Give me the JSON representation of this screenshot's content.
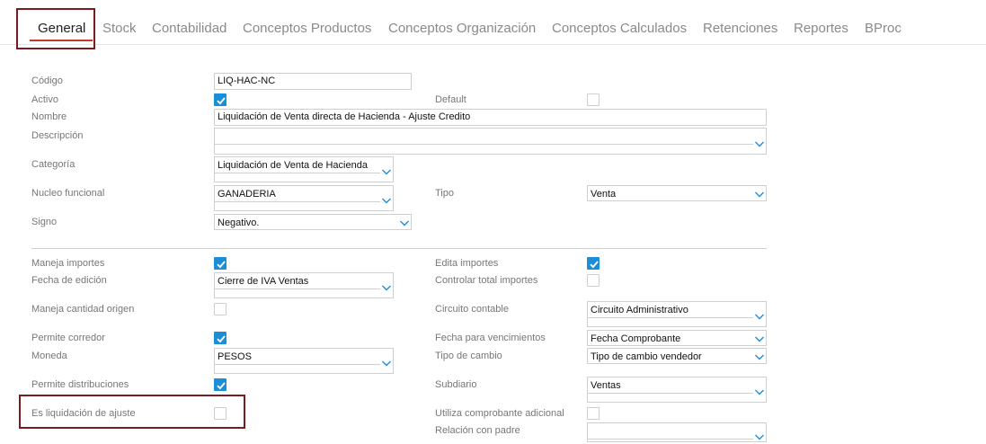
{
  "tabs": [
    {
      "label": "General",
      "active": true
    },
    {
      "label": "Stock"
    },
    {
      "label": "Contabilidad"
    },
    {
      "label": "Conceptos Productos"
    },
    {
      "label": "Conceptos Organización"
    },
    {
      "label": "Conceptos Calculados"
    },
    {
      "label": "Retenciones"
    },
    {
      "label": "Reportes"
    },
    {
      "label": "BProc"
    }
  ],
  "form": {
    "codigo": {
      "label": "Código",
      "value": "LIQ-HAC-NC"
    },
    "activo": {
      "label": "Activo",
      "checked": true
    },
    "default": {
      "label": "Default",
      "checked": false
    },
    "nombre": {
      "label": "Nombre",
      "value": "Liquidación de Venta directa de Hacienda - Ajuste Credito"
    },
    "descripcion": {
      "label": "Descripción",
      "value": ""
    },
    "categoria": {
      "label": "Categoría",
      "value": "Liquidación de Venta de Hacienda"
    },
    "nucleo": {
      "label": "Nucleo funcional",
      "value": "GANADERIA"
    },
    "tipo": {
      "label": "Tipo",
      "value": "Venta"
    },
    "signo": {
      "label": "Signo",
      "value": "Negativo."
    },
    "maneja_importes": {
      "label": "Maneja importes",
      "checked": true
    },
    "edita_importes": {
      "label": "Edita importes",
      "checked": true
    },
    "fecha_edicion": {
      "label": "Fecha de edición",
      "value": "Cierre de IVA Ventas"
    },
    "controlar_total": {
      "label": "Controlar total importes",
      "checked": false
    },
    "maneja_cantidad": {
      "label": "Maneja cantidad origen",
      "checked": false
    },
    "circuito": {
      "label": "Circuito contable",
      "value": "Circuito Administrativo"
    },
    "permite_corredor": {
      "label": "Permite corredor",
      "checked": true
    },
    "fecha_vencimientos": {
      "label": "Fecha para vencimientos",
      "value": "Fecha Comprobante"
    },
    "moneda": {
      "label": "Moneda",
      "value": "PESOS"
    },
    "tipo_cambio": {
      "label": "Tipo de cambio",
      "value": "Tipo de cambio vendedor"
    },
    "permite_distribuciones": {
      "label": "Permite distribuciones",
      "checked": true
    },
    "subdiario": {
      "label": "Subdiario",
      "value": "Ventas"
    },
    "es_liquidacion": {
      "label": "Es liquidación de ajuste",
      "checked": false
    },
    "utiliza_comprobante": {
      "label": "Utiliza comprobante adicional",
      "checked": false
    },
    "relacion_padre": {
      "label": "Relación con padre",
      "value": ""
    }
  },
  "colors": {
    "accent": "#1c8ed8",
    "tab_underline": "#c0392b",
    "highlight_box": "#7b1a1f"
  },
  "icons": {
    "checkbox_checked": "check-icon",
    "select_arrow": "chevron-down-icon"
  }
}
